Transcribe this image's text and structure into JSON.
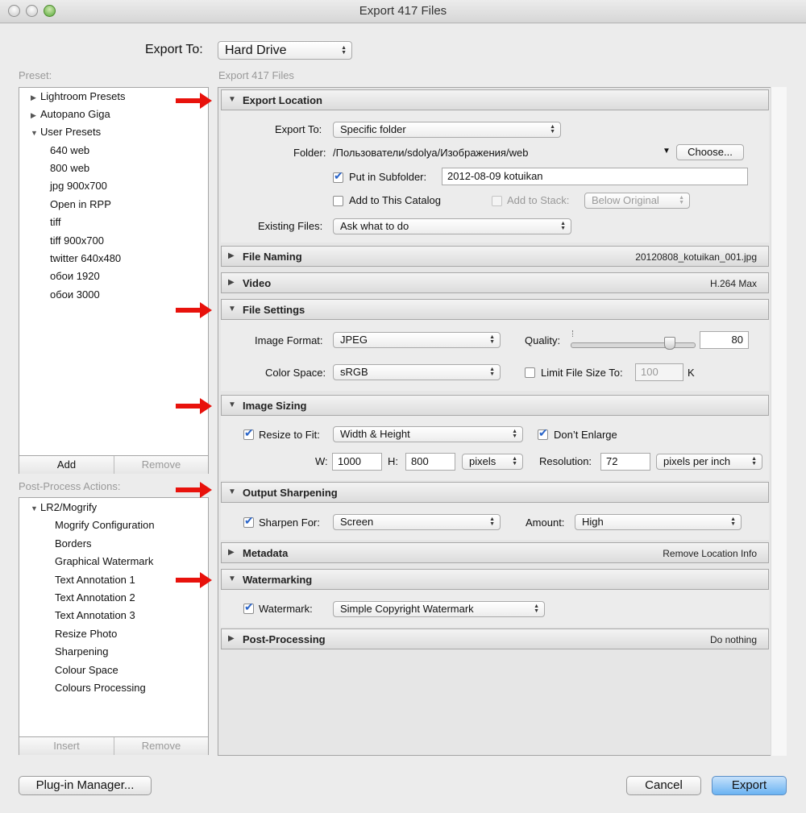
{
  "window": {
    "title": "Export 417 Files"
  },
  "export_to": {
    "label": "Export To:",
    "value": "Hard Drive"
  },
  "preset": {
    "header": "Preset:",
    "tree": [
      {
        "label": "Lightroom Presets",
        "expanded": false
      },
      {
        "label": "Autopano Giga",
        "expanded": false
      },
      {
        "label": "User Presets",
        "expanded": true
      }
    ],
    "user_presets": [
      "640 web",
      "800 web",
      "jpg 900x700",
      "Open in RPP",
      "tiff",
      "tiff 900x700",
      "twitter 640x480",
      "обои 1920",
      "обои 3000"
    ],
    "add_label": "Add",
    "remove_label": "Remove"
  },
  "post_process": {
    "header": "Post-Process Actions:",
    "group": "LR2/Mogrify",
    "items": [
      "Mogrify Configuration",
      "Borders",
      "Graphical Watermark",
      "Text Annotation 1",
      "Text Annotation 2",
      "Text Annotation 3",
      "Resize Photo",
      "Sharpening",
      "Colour Space",
      "Colours Processing"
    ],
    "insert_label": "Insert",
    "remove_label": "Remove"
  },
  "main_header": "Export 417 Files",
  "export_location": {
    "title": "Export Location",
    "export_to_label": "Export To:",
    "export_to_value": "Specific folder",
    "folder_label": "Folder:",
    "folder_value": "/Пользователи/sdolya/Изображения/web",
    "choose_label": "Choose...",
    "subfolder_label": "Put in Subfolder:",
    "subfolder_value": "2012-08-09 kotuikan",
    "subfolder_checked": true,
    "catalog_label": "Add to This Catalog",
    "catalog_checked": false,
    "stack_label": "Add to Stack:",
    "stack_checked": false,
    "stack_value": "Below Original",
    "existing_label": "Existing Files:",
    "existing_value": "Ask what to do"
  },
  "file_naming": {
    "title": "File Naming",
    "summary": "20120808_kotuikan_001.jpg"
  },
  "video": {
    "title": "Video",
    "summary": "H.264 Max"
  },
  "file_settings": {
    "title": "File Settings",
    "format_label": "Image Format:",
    "format_value": "JPEG",
    "quality_label": "Quality:",
    "quality_value": "80",
    "quality": 80,
    "color_space_label": "Color Space:",
    "color_space_value": "sRGB",
    "limit_label": "Limit File Size To:",
    "limit_checked": false,
    "limit_value": "100",
    "limit_unit": "K"
  },
  "image_sizing": {
    "title": "Image Sizing",
    "resize_label": "Resize to Fit:",
    "resize_checked": true,
    "resize_value": "Width & Height",
    "dont_enlarge_label": "Don’t Enlarge",
    "dont_enlarge_checked": true,
    "w_label": "W:",
    "w_value": "1000",
    "h_label": "H:",
    "h_value": "800",
    "unit_value": "pixels",
    "resolution_label": "Resolution:",
    "resolution_value": "72",
    "resolution_unit": "pixels per inch"
  },
  "output_sharpening": {
    "title": "Output Sharpening",
    "sharpen_label": "Sharpen For:",
    "sharpen_checked": true,
    "sharpen_value": "Screen",
    "amount_label": "Amount:",
    "amount_value": "High"
  },
  "metadata": {
    "title": "Metadata",
    "summary": "Remove Location Info"
  },
  "watermarking": {
    "title": "Watermarking",
    "watermark_label": "Watermark:",
    "watermark_checked": true,
    "watermark_value": "Simple Copyright Watermark"
  },
  "post_processing": {
    "title": "Post-Processing",
    "summary": "Do nothing"
  },
  "footer": {
    "plugin_manager": "Plug-in Manager...",
    "cancel": "Cancel",
    "export": "Export"
  },
  "colors": {
    "accent": "#2a64c8",
    "annotation_arrow": "#e8120c",
    "default_button": "#6ab3f2"
  }
}
